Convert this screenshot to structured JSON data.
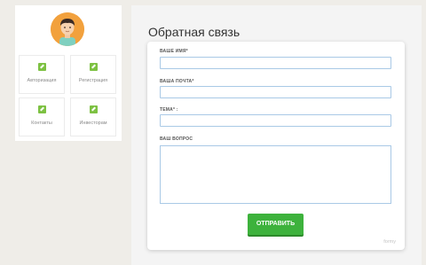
{
  "sidebar": {
    "avatar_name": "user-avatar",
    "tiles": [
      {
        "label": "Авторизация",
        "icon": "arrow-icon"
      },
      {
        "label": "Регистрация",
        "icon": "arrow-icon"
      },
      {
        "label": "Контакты",
        "icon": "arrow-icon"
      },
      {
        "label": "Инвесторам",
        "icon": "arrow-icon"
      }
    ]
  },
  "main": {
    "title": "Обратная связь",
    "form": {
      "name_label": "ВАШЕ ИМЯ*",
      "email_label": "ВАША ПОЧТА*",
      "subject_label": "ТЕМА* :",
      "question_label": "ВАШ ВОПРОС",
      "submit_label": "ОТПРАВИТЬ",
      "brand": "formy"
    }
  },
  "colors": {
    "background": "#efede8",
    "accent_green": "#3db23c",
    "input_border": "#a9c9e6",
    "avatar_orange": "#f2a13d"
  }
}
